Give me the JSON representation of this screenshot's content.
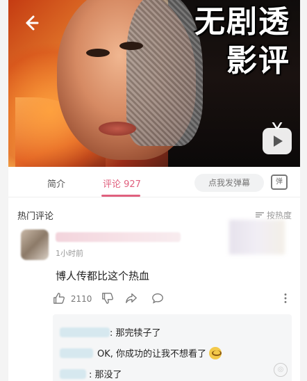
{
  "video": {
    "headline_line1": "无剧透",
    "headline_line2": "影评"
  },
  "tabs": {
    "intro": "简介",
    "comments": "评论 927"
  },
  "danmaku": {
    "placeholder": "点我发弹幕",
    "icon_label": "弹"
  },
  "comments_header": {
    "title": "热门评论",
    "sort_label": "按热度"
  },
  "comment": {
    "time": "1小时前",
    "text": "博人传都比这个热血",
    "likes": "2110"
  },
  "replies": [
    {
      "text": ": 那完犊子了"
    },
    {
      "text": "OK, 你成功的让我不想看了"
    },
    {
      "text": ": 那没了"
    }
  ],
  "icons": [
    "back-arrow-icon",
    "tv-play-icon",
    "danmaku-icon",
    "sort-icon",
    "like-icon",
    "dislike-icon",
    "share-icon",
    "reply-icon",
    "more-icon",
    "emoji-icon"
  ]
}
